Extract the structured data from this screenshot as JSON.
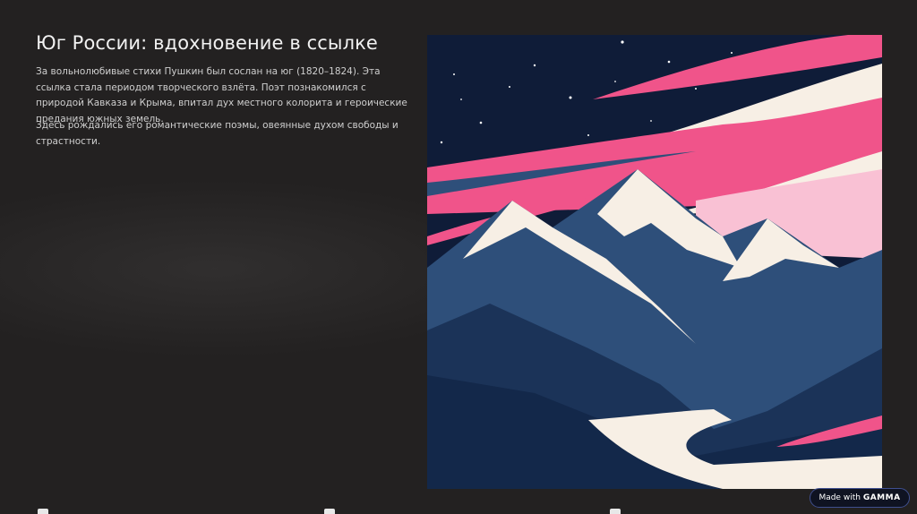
{
  "slide": {
    "title": "Юг России: вдохновение в ссылке",
    "paragraphs": [
      "За вольнолюбивые стихи Пушкин был сослан на юг (1820–1824). Эта ссылка стала периодом творческого взлёта. Поэт познакомился с природой Кавказа и Крыма, впитал дух местного колорита и героические предания южных земель.",
      "Здесь рождались его романтические поэмы, овеянные духом свободы и страстности."
    ]
  },
  "illustration": {
    "subject": "mountain-landscape-illustration",
    "colors": {
      "sky": "#0f1c38",
      "pink": "#f0548a",
      "light_pink": "#f9c1d4",
      "cream": "#f7efe5",
      "mountain_blue": "#2e4f7a",
      "deep_blue": "#1b3358",
      "forest": "#13284a"
    }
  },
  "badge": {
    "prefix": "Made with",
    "brand": "GAMMA"
  },
  "footer": {
    "icon": "card-icon"
  }
}
